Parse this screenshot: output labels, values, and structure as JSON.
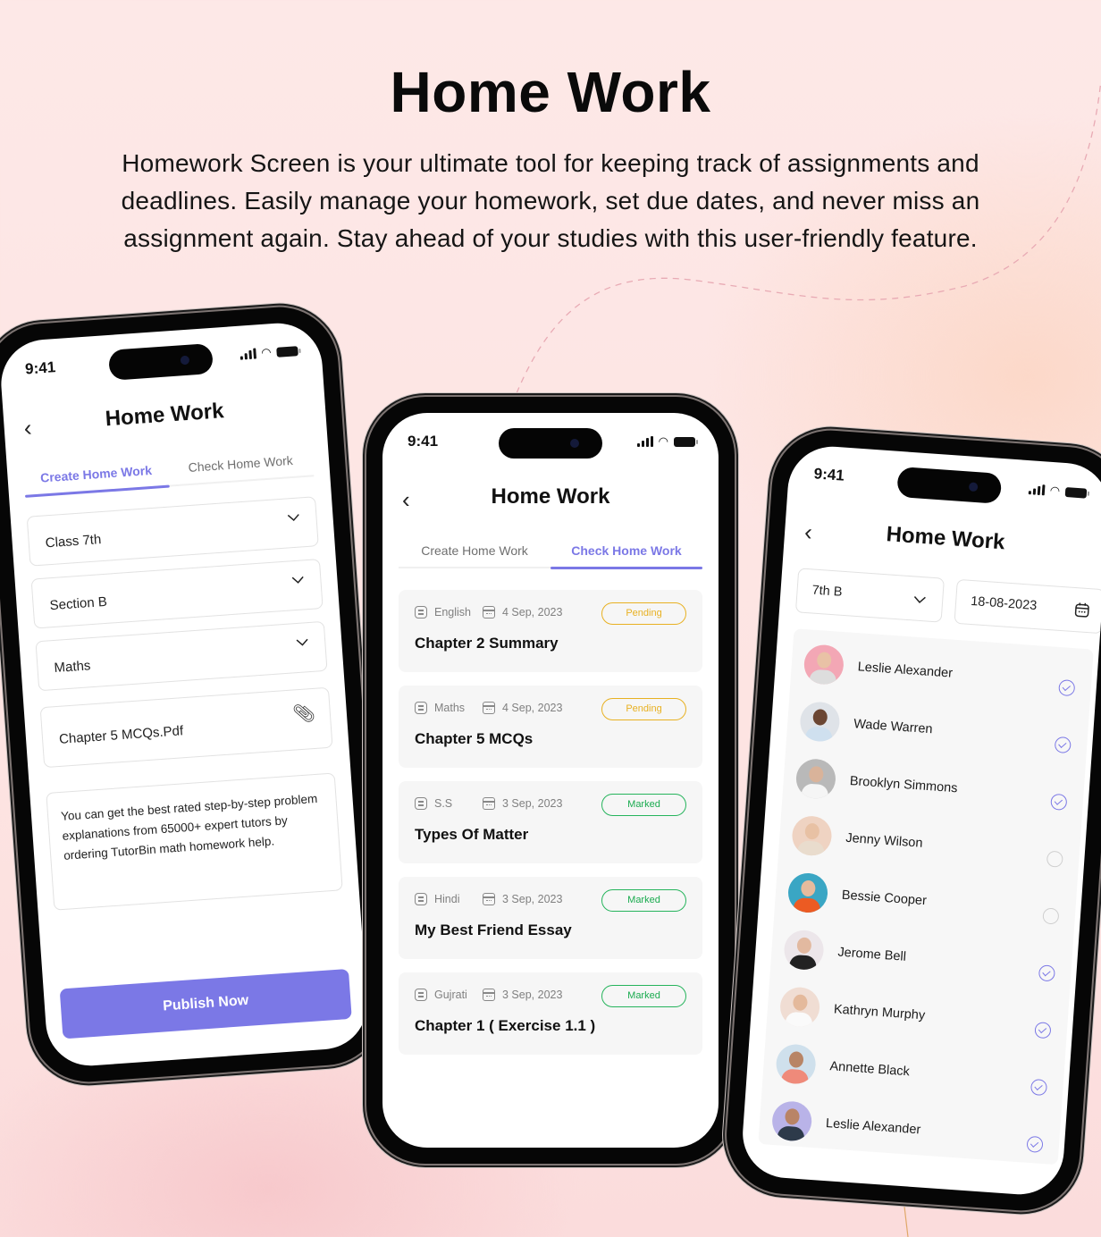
{
  "hero": {
    "title": "Home Work",
    "description": "Homework Screen is your ultimate tool for keeping track of assignments and deadlines. Easily manage your homework, set due dates, and never miss an assignment again. Stay ahead of your studies with this user-friendly feature."
  },
  "colors": {
    "accent": "#7b78e6",
    "pending": "#e8b122",
    "marked": "#1aab4f",
    "card_bg": "#f6f6f6"
  },
  "status_bar": {
    "time": "9:41"
  },
  "screen_title": "Home Work",
  "tabs": {
    "create": "Create Home Work",
    "check": "Check Home Work"
  },
  "create_form": {
    "class": "Class 7th",
    "section": "Section B",
    "subject": "Maths",
    "attachment": "Chapter 5 MCQs.Pdf",
    "description": "You can get the best rated step-by-step problem explanations from 65000+ expert tutors by ordering TutorBin math homework help.",
    "publish_label": "Publish Now"
  },
  "homework_list": [
    {
      "subject": "English",
      "date": "4 Sep, 2023",
      "title": "Chapter 2 Summary",
      "status": "Pending"
    },
    {
      "subject": "Maths",
      "date": "4 Sep, 2023",
      "title": "Chapter 5 MCQs",
      "status": "Pending"
    },
    {
      "subject": "S.S",
      "date": "3 Sep, 2023",
      "title": "Types Of Matter",
      "status": "Marked"
    },
    {
      "subject": "Hindi",
      "date": "3 Sep, 2023",
      "title": "My Best Friend Essay",
      "status": "Marked"
    },
    {
      "subject": "Gujrati",
      "date": "3 Sep, 2023",
      "title": "Chapter 1 ( Exercise 1.1 )",
      "status": "Marked"
    }
  ],
  "check_filters": {
    "class_section": "7th B",
    "date": "18-08-2023"
  },
  "students": [
    {
      "name": "Leslie Alexander",
      "checked": true,
      "avatar_bg": "#f3a7b5",
      "skin": "#e9c2a6",
      "shirt": "#ddd"
    },
    {
      "name": "Wade Warren",
      "checked": true,
      "avatar_bg": "#dfe3e8",
      "skin": "#6b4633",
      "shirt": "#cfe0ef"
    },
    {
      "name": "Brooklyn Simmons",
      "checked": true,
      "avatar_bg": "#b9b9b9",
      "skin": "#d9b39a",
      "shirt": "#f5f5f5"
    },
    {
      "name": "Jenny Wilson",
      "checked": false,
      "avatar_bg": "#efd3c2",
      "skin": "#e8c1a4",
      "shirt": "#e9dccd"
    },
    {
      "name": "Bessie Cooper",
      "checked": false,
      "avatar_bg": "#3aa6c4",
      "skin": "#e6bb9d",
      "shirt": "#ec5b23"
    },
    {
      "name": "Jerome Bell",
      "checked": true,
      "avatar_bg": "#ece6ea",
      "skin": "#e2b9a0",
      "shirt": "#222"
    },
    {
      "name": "Kathryn Murphy",
      "checked": true,
      "avatar_bg": "#f0ddd3",
      "skin": "#e4b99b",
      "shirt": "#fafafa"
    },
    {
      "name": "Annette Black",
      "checked": true,
      "avatar_bg": "#cfe0ec",
      "skin": "#b88566",
      "shirt": "#ef8a7a"
    },
    {
      "name": "Leslie Alexander",
      "checked": true,
      "avatar_bg": "#b9b3e8",
      "skin": "#b98466",
      "shirt": "#2d3a4a"
    }
  ]
}
